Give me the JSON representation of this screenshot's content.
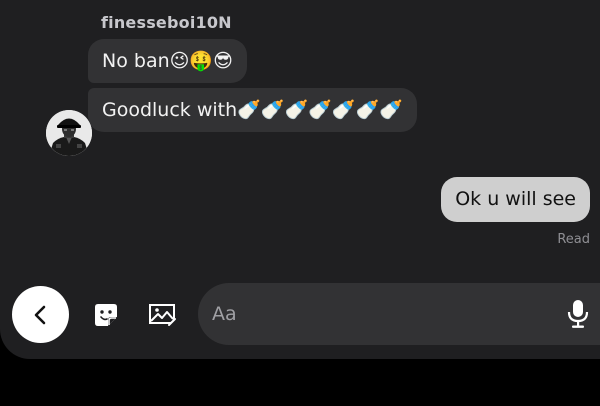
{
  "conversation": {
    "sender_name": "finesseboi10N",
    "incoming": [
      {
        "text": "No ban😉🤑😎"
      },
      {
        "text": "Goodluck with🍼🍼🍼🍼🍼🍼🍼"
      }
    ],
    "outgoing": [
      {
        "text": "Ok u will see"
      }
    ],
    "read_status": "Read"
  },
  "composer": {
    "placeholder": "Aa"
  },
  "icons": {
    "back": "chevron-left-icon",
    "sticker": "sticker-icon",
    "image": "image-icon",
    "mic": "microphone-icon"
  },
  "colors": {
    "background": "#1f1f21",
    "incoming_bubble": "#323234",
    "outgoing_bubble": "#cfcfcf",
    "composer": "#323234",
    "back_button": "#ffffff"
  }
}
